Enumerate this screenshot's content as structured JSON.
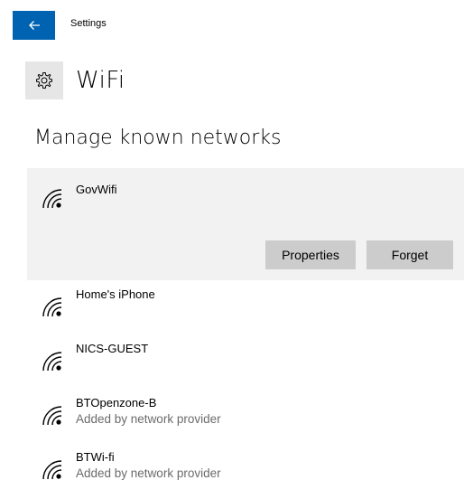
{
  "titlebar": {
    "app_title": "Settings"
  },
  "page": {
    "title": "WiFi",
    "section_title": "Manage known networks"
  },
  "networks": [
    {
      "name": "GovWifi",
      "sub": "",
      "selected": true
    },
    {
      "name": "Home's iPhone",
      "sub": ""
    },
    {
      "name": "NICS-GUEST",
      "sub": ""
    },
    {
      "name": "BTOpenzone-B",
      "sub": "Added by network provider"
    },
    {
      "name": "BTWi-fi",
      "sub": "Added by network provider"
    }
  ],
  "actions": {
    "properties_label": "Properties",
    "forget_label": "Forget"
  },
  "colors": {
    "accent": "#0063b1",
    "selected_bg": "#f2f2f2",
    "button_bg": "#cccccc",
    "secondary_text": "#6b6b6b"
  },
  "icons": {
    "back": "back-arrow-icon",
    "settings": "gear-icon",
    "network": "wifi-icon"
  }
}
